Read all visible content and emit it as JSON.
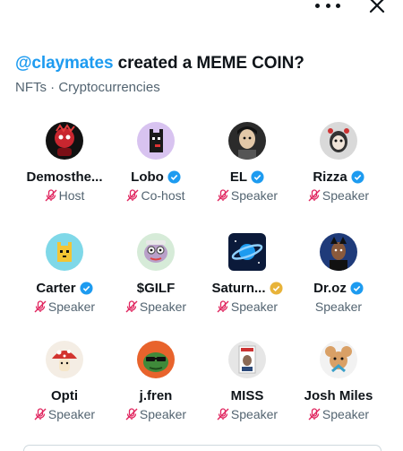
{
  "header": {
    "more_icon": "more-horizontal-icon",
    "close_icon": "close-icon"
  },
  "space": {
    "handle": "@claymates",
    "title_rest": " created a MEME COIN?",
    "topics": "NFTs · Cryptocurrencies"
  },
  "colors": {
    "accent": "#1d9bf0",
    "muted_mic": "#e0245e",
    "gold_badge": "#e8b339"
  },
  "participants": [
    {
      "name": "Demosthe...",
      "role": "Host",
      "verified": "",
      "muted": true
    },
    {
      "name": "Lobo",
      "role": "Co-host",
      "verified": "blue",
      "muted": true
    },
    {
      "name": "EL",
      "role": "Speaker",
      "verified": "blue",
      "muted": true
    },
    {
      "name": "Rizza",
      "role": "Speaker",
      "verified": "blue",
      "muted": true
    },
    {
      "name": "Carter",
      "role": "Speaker",
      "verified": "blue",
      "muted": true
    },
    {
      "name": "$GILF",
      "role": "Speaker",
      "verified": "",
      "muted": true
    },
    {
      "name": "Saturn...",
      "role": "Speaker",
      "verified": "gold",
      "muted": true
    },
    {
      "name": "Dr.oz",
      "role": "Speaker",
      "verified": "blue",
      "muted": false
    },
    {
      "name": "Opti",
      "role": "Speaker",
      "verified": "",
      "muted": true
    },
    {
      "name": "j.fren",
      "role": "Speaker",
      "verified": "",
      "muted": true
    },
    {
      "name": "MISS",
      "role": "Speaker",
      "verified": "",
      "muted": true
    },
    {
      "name": "Josh Miles",
      "role": "Speaker",
      "verified": "",
      "muted": true
    }
  ]
}
